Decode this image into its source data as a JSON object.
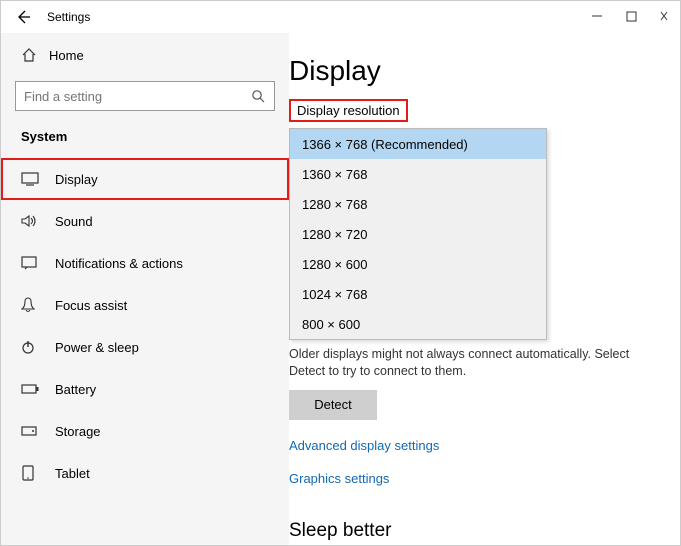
{
  "window": {
    "title": "Settings"
  },
  "sidebar": {
    "home_label": "Home",
    "search_placeholder": "Find a setting",
    "category_label": "System",
    "items": [
      {
        "label": "Display"
      },
      {
        "label": "Sound"
      },
      {
        "label": "Notifications & actions"
      },
      {
        "label": "Focus assist"
      },
      {
        "label": "Power & sleep"
      },
      {
        "label": "Battery"
      },
      {
        "label": "Storage"
      },
      {
        "label": "Tablet"
      }
    ]
  },
  "main": {
    "heading": "Display",
    "resolution_label": "Display resolution",
    "resolution_options": [
      "1366 × 768 (Recommended)",
      "1360 × 768",
      "1280 × 768",
      "1280 × 720",
      "1280 × 600",
      "1024 × 768",
      "800 × 600"
    ],
    "helper_text": "Older displays might not always connect automatically. Select Detect to try to connect to them.",
    "detect_label": "Detect",
    "link_advanced": "Advanced display settings",
    "link_graphics": "Graphics settings",
    "sleep_heading": "Sleep better"
  }
}
